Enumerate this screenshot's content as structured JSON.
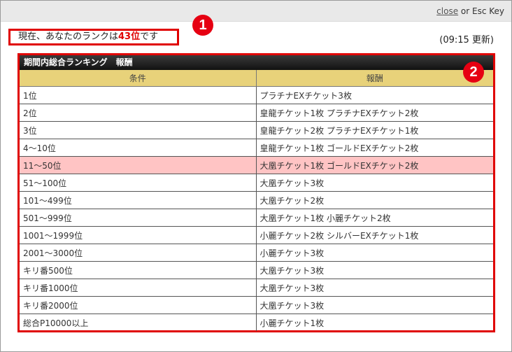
{
  "topbar": {
    "close_label": "close",
    "close_suffix": " or Esc Key"
  },
  "rank": {
    "prefix": "現在、あなたのランクは",
    "value": "43位",
    "suffix": "です"
  },
  "time_update": "(09:15 更新)",
  "badges": [
    "1",
    "2"
  ],
  "table": {
    "title": "期間内総合ランキング　報酬",
    "headers": [
      "条件",
      "報酬"
    ],
    "rows": [
      [
        "1位",
        "プラチナEXチケット3枚"
      ],
      [
        "2位",
        "皇龍チケット1枚 プラチナEXチケット2枚"
      ],
      [
        "3位",
        "皇龍チケット2枚 プラチナEXチケット1枚"
      ],
      [
        "4～10位",
        "皇龍チケット1枚 ゴールドEXチケット2枚"
      ],
      [
        "11～50位",
        "大凰チケット1枚 ゴールドEXチケット2枚"
      ],
      [
        "51～100位",
        "大凰チケット3枚"
      ],
      [
        "101～499位",
        "大凰チケット2枚"
      ],
      [
        "501～999位",
        "大凰チケット1枚 小麗チケット2枚"
      ],
      [
        "1001～1999位",
        "小麗チケット2枚 シルバーEXチケット1枚"
      ],
      [
        "2001～3000位",
        "小麗チケット3枚"
      ],
      [
        "キリ番500位",
        "大凰チケット3枚"
      ],
      [
        "キリ番1000位",
        "大凰チケット3枚"
      ],
      [
        "キリ番2000位",
        "大凰チケット3枚"
      ],
      [
        "総合P10000以上",
        "小麗チケット1枚"
      ]
    ],
    "highlight_row_index": 4,
    "highlight_color": "#ffc4c4"
  },
  "colors": {
    "accent_red": "#e00000",
    "header_gold": "#e8d27a"
  }
}
